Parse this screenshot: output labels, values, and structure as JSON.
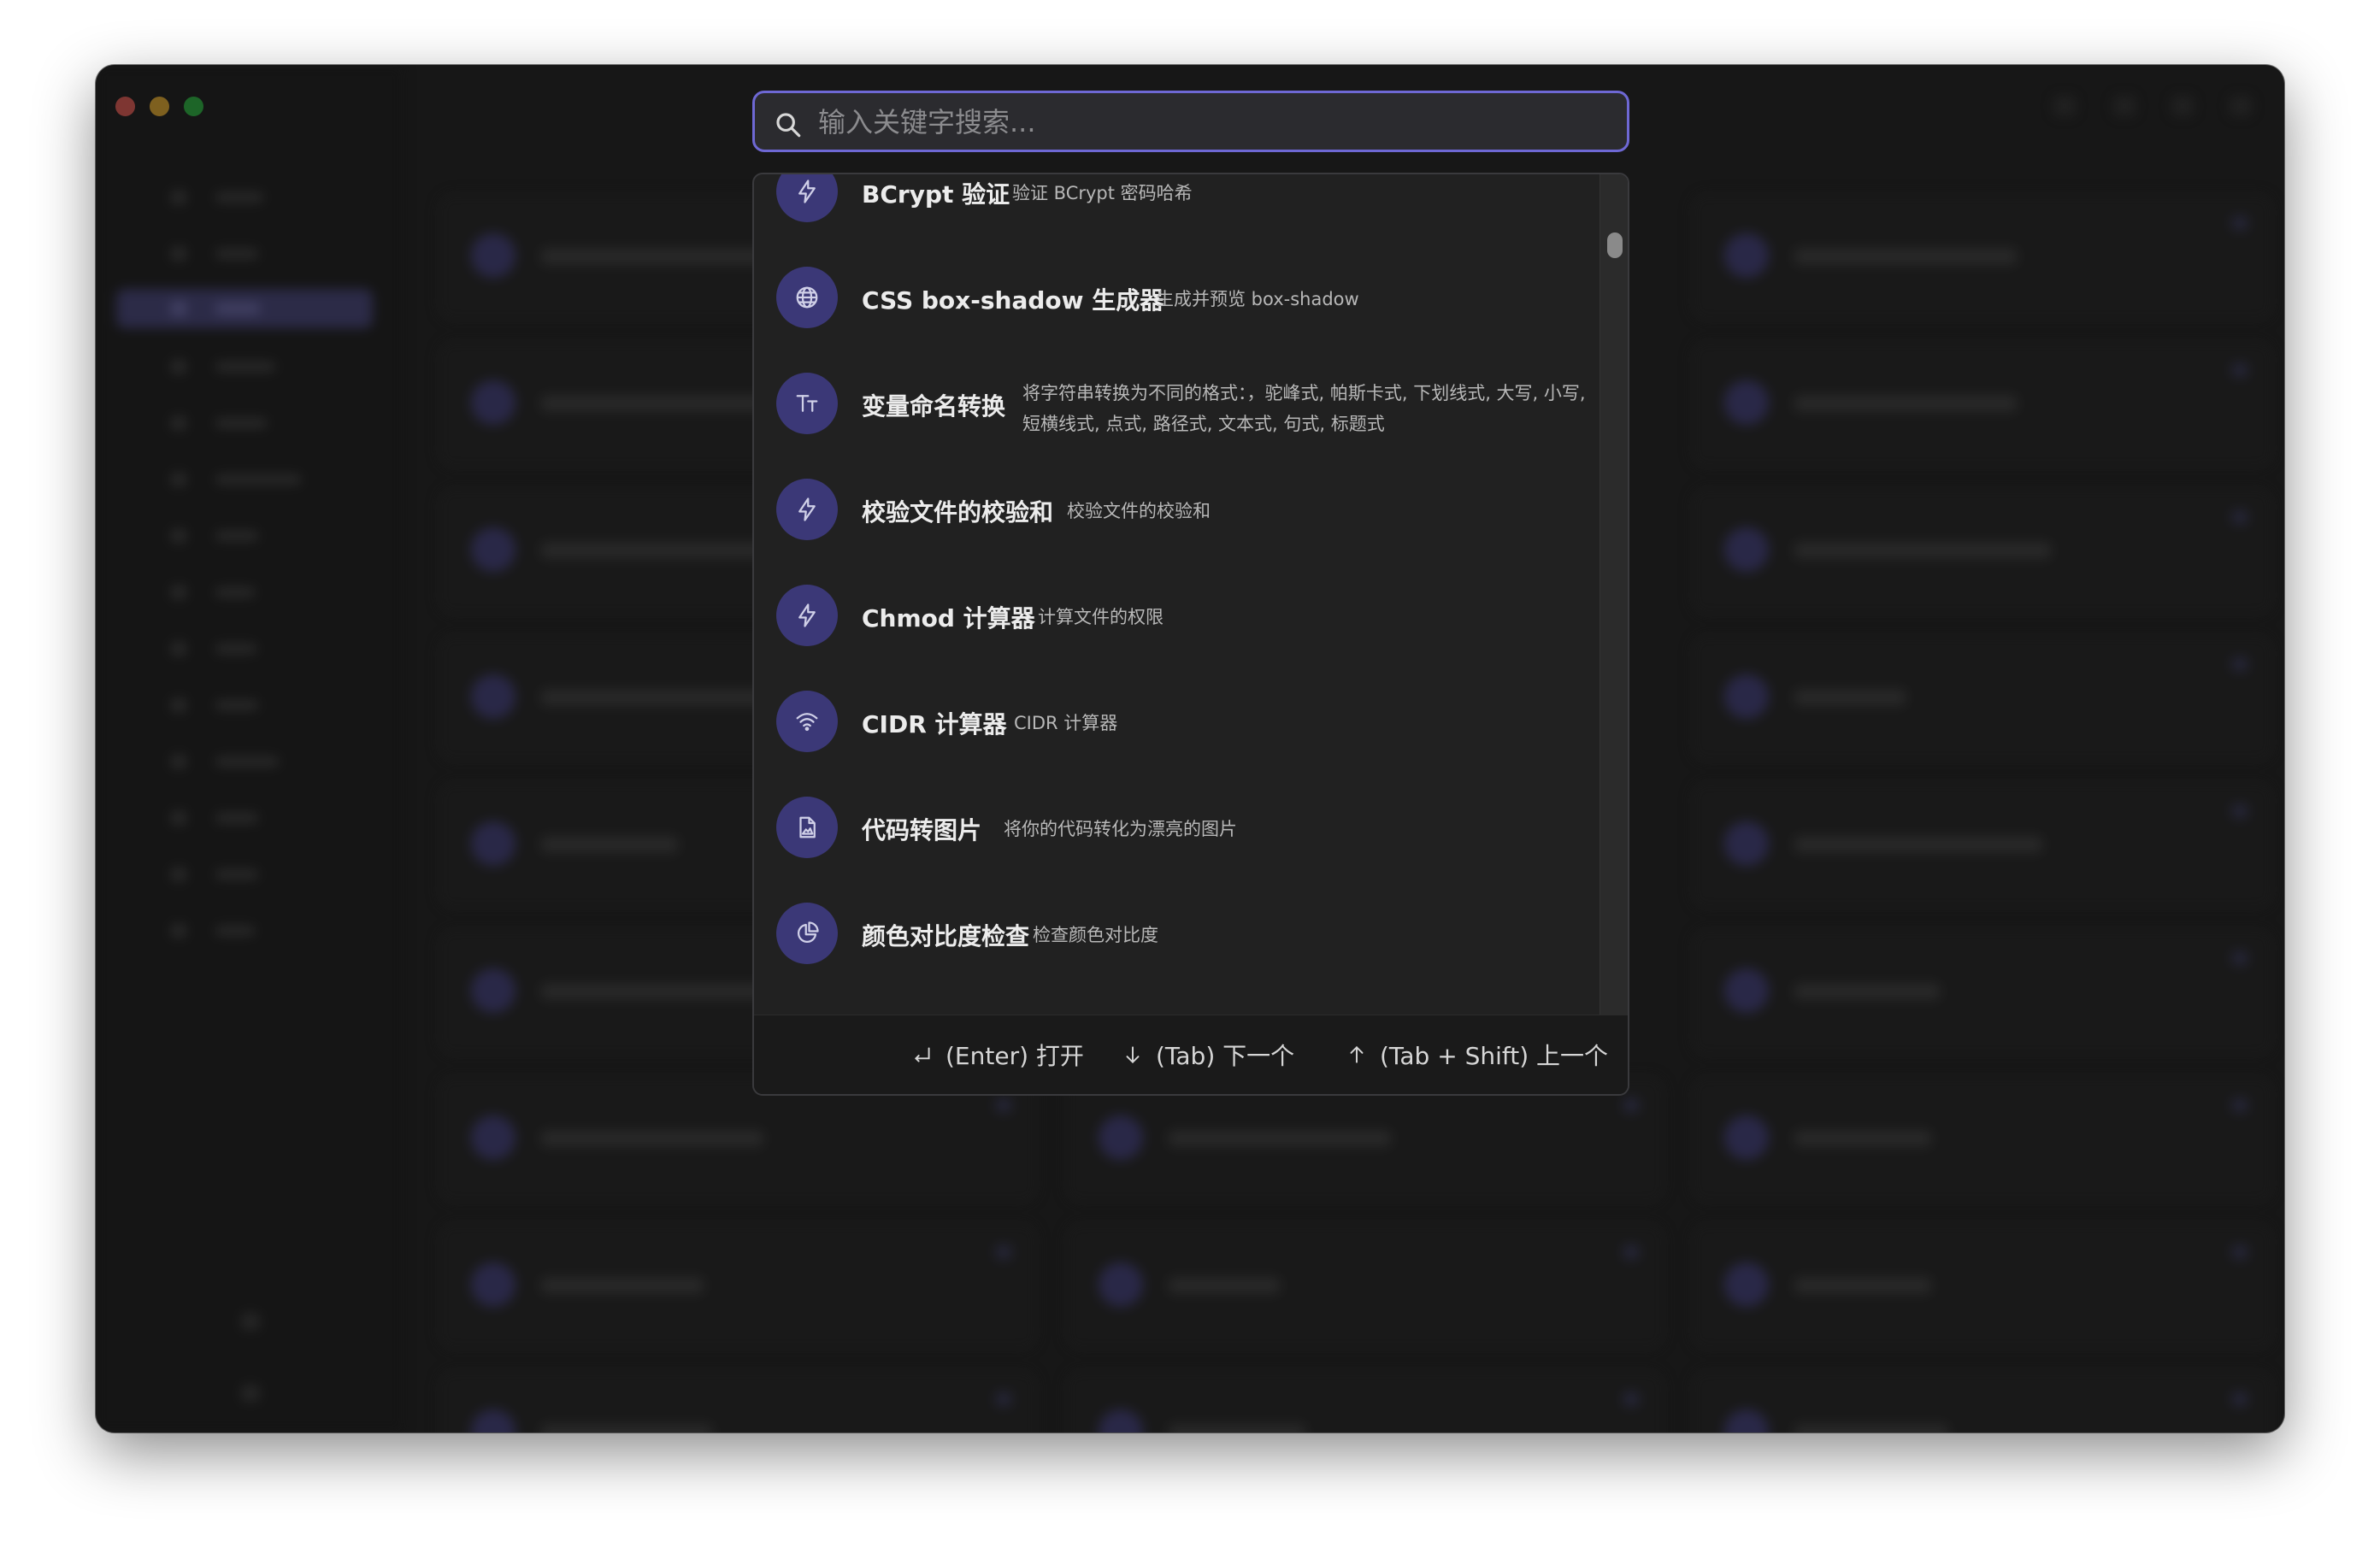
{
  "search": {
    "placeholder": "输入关键字搜索..."
  },
  "tools": [
    {
      "name": "BCrypt 验证",
      "description": "验证 BCrypt 密码哈希",
      "icon": "bolt-icon"
    },
    {
      "name": "CSS box-shadow 生成器",
      "description": "生成并预览 box-shadow",
      "icon": "globe-icon"
    },
    {
      "name": "变量命名转换",
      "description": "将字符串转换为不同的格式：，驼峰式, 帕斯卡式, 下划线式, 大写, 小写, 短横线式, 点式, 路径式, 文本式, 句式, 标题式",
      "icon": "text-case-icon"
    },
    {
      "name": "校验文件的校验和",
      "description": "校验文件的校验和",
      "icon": "bolt-icon"
    },
    {
      "name": "Chmod 计算器",
      "description": "计算文件的权限",
      "icon": "bolt-icon"
    },
    {
      "name": "CIDR 计算器",
      "description": "CIDR 计算器",
      "icon": "wifi-icon"
    },
    {
      "name": "代码转图片",
      "description": "将你的代码转化为漂亮的图片",
      "icon": "file-image-icon"
    },
    {
      "name": "颜色对比度检查",
      "description": "检查颜色对比度",
      "icon": "pie-chart-icon"
    }
  ],
  "footer": {
    "enter": "(Enter) 打开",
    "tab": "(Tab)  下一个",
    "shift_tab": "(Tab + Shift)  上一个"
  },
  "colors": {
    "accent": "#6e68d4",
    "icon_circle": "#3b3877",
    "window_bg": "#171717",
    "palette_bg": "#212121"
  }
}
